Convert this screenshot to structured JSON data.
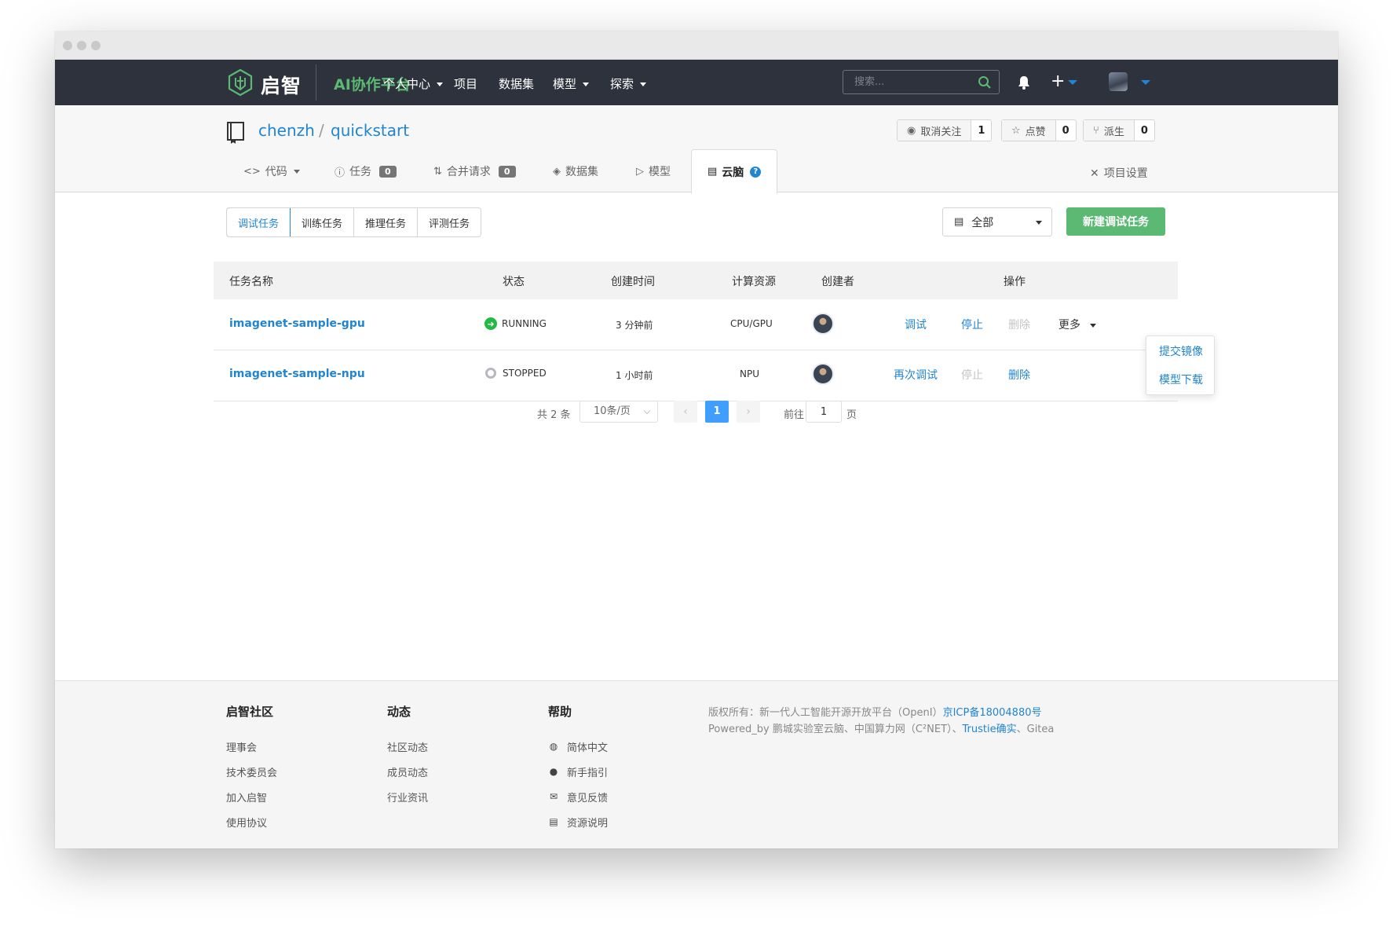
{
  "navbar": {
    "brand": "启智",
    "platform": "AI协作平台",
    "links": [
      "个人中心",
      "项目",
      "数据集",
      "模型",
      "探索"
    ],
    "search_placeholder": "搜索..."
  },
  "repo": {
    "owner": "chenzh",
    "separator": "/",
    "name": "quickstart",
    "watch_label": "取消关注",
    "watch_count": "1",
    "star_label": "点赞",
    "star_count": "0",
    "fork_label": "派生",
    "fork_count": "0"
  },
  "tabs": {
    "code": "代码",
    "issues": "任务",
    "issues_count": "0",
    "pulls": "合并请求",
    "pulls_count": "0",
    "datasets": "数据集",
    "models": "模型",
    "cloudbrain": "云脑",
    "settings": "项目设置"
  },
  "segments": [
    "调试任务",
    "训练任务",
    "推理任务",
    "评测任务"
  ],
  "filter": {
    "selected": "全部"
  },
  "new_button": "新建调试任务",
  "table": {
    "columns": [
      "任务名称",
      "状态",
      "创建时间",
      "计算资源",
      "创建者",
      "操作"
    ],
    "rows": [
      {
        "name": "imagenet-sample-gpu",
        "status": "RUNNING",
        "created": "3 分钟前",
        "resource": "CPU/GPU",
        "action1": "调试",
        "action2": "停止",
        "action3": "删除",
        "more": "更多"
      },
      {
        "name": "imagenet-sample-npu",
        "status": "STOPPED",
        "created": "1 小时前",
        "resource": "NPU",
        "action1": "再次调试",
        "action2": "停止",
        "action3": "删除"
      }
    ]
  },
  "more_menu": [
    "提交镜像",
    "模型下载"
  ],
  "pagination": {
    "total": "共 2 条",
    "page_size": "10条/页",
    "current": "1",
    "goto_label": "前往",
    "goto_value": "1",
    "page_suffix": "页"
  },
  "footer": {
    "community_title": "启智社区",
    "community_links": [
      "理事会",
      "技术委员会",
      "加入启智",
      "使用协议"
    ],
    "news_title": "动态",
    "news_links": [
      "社区动态",
      "成员动态",
      "行业资讯"
    ],
    "help_title": "帮助",
    "help_links": [
      "简体中文",
      "新手指引",
      "意见反馈",
      "资源说明"
    ],
    "copyright_prefix": "版权所有：新一代人工智能开源开放平台（OpenI）",
    "icp": "京ICP备18004880号",
    "powered_prefix": "Powered_by 鹏城实验室云脑、中国算力网（C²NET）、",
    "trustie": "Trustie确实",
    "powered_suffix": "、Gitea"
  }
}
